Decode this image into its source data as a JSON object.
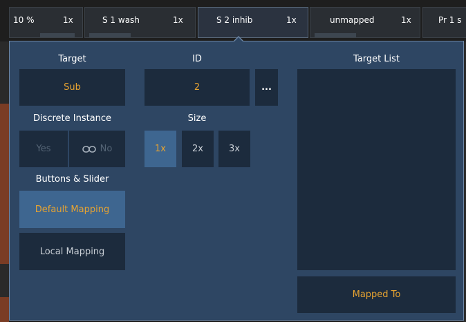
{
  "fader_tabs": [
    {
      "label": "10 %",
      "size": "1x"
    },
    {
      "label": "S 1  wash",
      "size": "1x"
    },
    {
      "label": "S 2  inhib",
      "size": "1x"
    },
    {
      "label": "unmapped",
      "size": "1x"
    },
    {
      "label": "Pr 1  s",
      "size": ""
    }
  ],
  "popup": {
    "target": {
      "header": "Target",
      "value": "Sub"
    },
    "id": {
      "header": "ID",
      "value": "2",
      "more_label": "..."
    },
    "target_list": {
      "header": "Target List",
      "mapped_to": "Mapped To"
    },
    "discrete_instance": {
      "header": "Discrete Instance",
      "yes": "Yes",
      "no": "No",
      "link_icon": "link-icon"
    },
    "size": {
      "header": "Size",
      "options": [
        "1x",
        "2x",
        "3x"
      ],
      "selected": "1x"
    },
    "buttons_slider": {
      "header": "Buttons & Slider",
      "default_mapping": "Default Mapping",
      "local_mapping": "Local Mapping",
      "selected": "Default Mapping"
    }
  },
  "colors": {
    "accent": "#e8a431",
    "popup_bg": "#2e4663",
    "field_bg": "#1c2b3d",
    "selected_bg": "#3e6690"
  }
}
